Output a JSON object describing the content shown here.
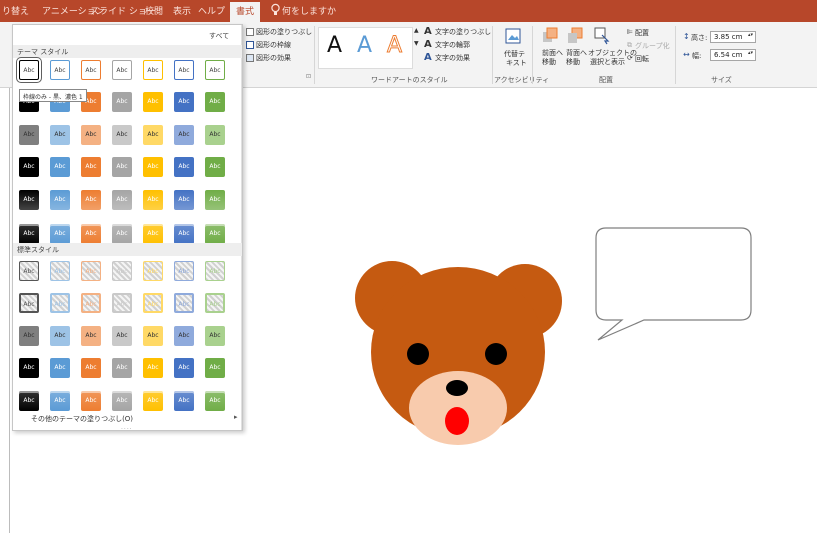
{
  "tabs": [
    {
      "id": "transitions",
      "label": "り替え"
    },
    {
      "id": "animations",
      "label": "アニメーション"
    },
    {
      "id": "slideshow",
      "label": "スライド ショー"
    },
    {
      "id": "review",
      "label": "校閲"
    },
    {
      "id": "view",
      "label": "表示"
    },
    {
      "id": "help",
      "label": "ヘルプ"
    },
    {
      "id": "format",
      "label": "書式"
    }
  ],
  "active_tab": "書式",
  "tell_me": "何をしますか",
  "ribbon": {
    "shape_styles": {
      "fill": "図形の塗りつぶし",
      "outline": "図形の枠線",
      "effects": "図形の効果",
      "launcher": "⊡"
    },
    "wordart": {
      "group_label": "ワードアートのスタイル",
      "letters": [
        "A",
        "A",
        "A"
      ],
      "text_fill": "文字の塗りつぶし",
      "text_outline": "文字の輪郭",
      "text_effects": "文字の効果"
    },
    "accessibility": {
      "alt_text_line1": "代替テ",
      "alt_text_line2": "キスト",
      "group_label": "アクセシビリティ"
    },
    "arrange": {
      "bring_forward_line1": "前面へ",
      "bring_forward_line2": "移動",
      "send_backward_line1": "背面へ",
      "send_backward_line2": "移動",
      "selection_pane_line1": "オブジェクトの",
      "selection_pane_line2": "選択と表示",
      "align": "配置",
      "group": "グループ化",
      "rotate": "回転",
      "group_label": "配置"
    },
    "size": {
      "height_label": "高さ:",
      "height_value": "3.85 cm",
      "width_label": "幅:",
      "width_value": "6.54 cm",
      "group_label": "サイズ"
    }
  },
  "gallery": {
    "all_label": "すべて",
    "theme_styles_header": "テーマ スタイル",
    "standard_styles_header": "標準スタイル",
    "swatch_text": "Abc",
    "tooltip": "枠線のみ - 黒、濃色 1",
    "more_fills": "その他のテーマの塗りつぶし(O)",
    "more_arrow": "▸",
    "grip": "....",
    "theme_colors": [
      "#000000",
      "#5b9bd5",
      "#ed7d31",
      "#a5a5a5",
      "#ffc000",
      "#4472c4",
      "#70ad47"
    ],
    "light_colors": [
      "#7f7f7f",
      "#9dc3e6",
      "#f4b183",
      "#c9c9c9",
      "#ffd966",
      "#8faadc",
      "#a9d18e"
    ]
  },
  "slide": {
    "callout_text": "",
    "bear": {
      "fur_color": "#c55a11",
      "muzzle_color": "#f8cbad",
      "nose_color": "#000000",
      "tongue_color": "#ff0000"
    }
  }
}
